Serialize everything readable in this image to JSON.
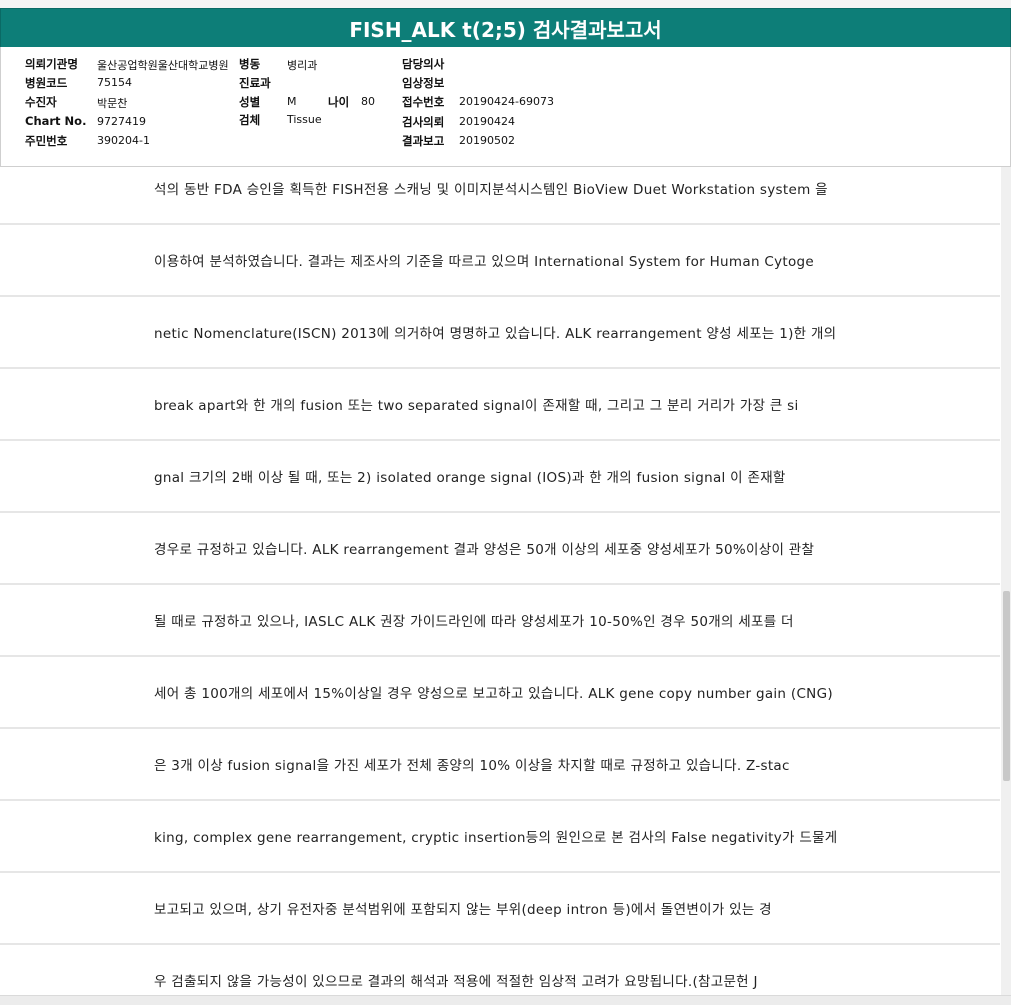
{
  "report": {
    "title": "FISH_ALK t(2;5) 검사결과보고서"
  },
  "info": {
    "institution_label": "의뢰기관명",
    "institution_value": "울산공업학원울산대학교병원",
    "ward_label": "병동",
    "ward_value": "병리과",
    "doctor_label": "담당의사",
    "doctor_value": "",
    "hospital_code_label": "병원코드",
    "hospital_code_value": "75154",
    "department_label": "진료과",
    "department_value": "",
    "clinical_label": "임상정보",
    "clinical_value": "",
    "patient_label": "수진자",
    "patient_value": "박문찬",
    "sex_label": "성별",
    "sex_value": "M",
    "age_label": "나이",
    "age_value": "80",
    "accession_label": "접수번호",
    "accession_value": "20190424-69073",
    "chart_label": "Chart No.",
    "chart_value": "9727419",
    "specimen_label": "검체",
    "specimen_value": "Tissue",
    "request_label": "검사의뢰",
    "request_value": "20190424",
    "resident_label": "주민번호",
    "resident_value": "390204-1",
    "report_date_label": "결과보고",
    "report_date_value": "20190502"
  },
  "lines": [
    "석의 동반 FDA 승인을 획득한 FISH전용 스캐닝 및 이미지분석시스템인 BioView Duet Workstation system 을",
    " 이용하여 분석하였습니다. 결과는 제조사의 기준을 따르고 있으며 International System for Human Cytoge",
    "netic Nomenclature(ISCN) 2013에 의거하여 명명하고 있습니다. ALK rearrangement 양성 세포는 1)한 개의",
    "break apart와 한 개의 fusion 또는 two separated signal이 존재할 때, 그리고 그 분리 거리가 가장 큰 si",
    "gnal 크기의 2배 이상 될 때, 또는 2) isolated orange signal (IOS)과 한 개의 fusion signal 이 존재할",
    "경우로 규정하고 있습니다. ALK rearrangement 결과 양성은 50개 이상의 세포중 양성세포가 50%이상이 관찰",
    "될 때로 규정하고 있으나, IASLC ALK 권장 가이드라인에 따라 양성세포가 10-50%인 경우 50개의 세포를 더",
    "세어 총 100개의 세포에서 15%이상일 경우 양성으로 보고하고 있습니다. ALK gene copy number gain (CNG)",
    "은 3개 이상 fusion signal을 가진 세포가 전체 종양의 10% 이상을 차지할 때로 규정하고 있습니다. Z-stac",
    "king, complex gene rearrangement, cryptic insertion등의 원인으로 본 검사의 False negativity가 드물게",
    " 보고되고 있으며, 상기 유전자중 분석범위에 포함되지 않는 부위(deep intron 등)에서 돌연변이가 있는 경",
    "우 검출되지 않을 가능성이 있으므로 결과의 해석과 적용에 적절한 임상적 고려가 요망됩니다.(참고문헌 J"
  ]
}
